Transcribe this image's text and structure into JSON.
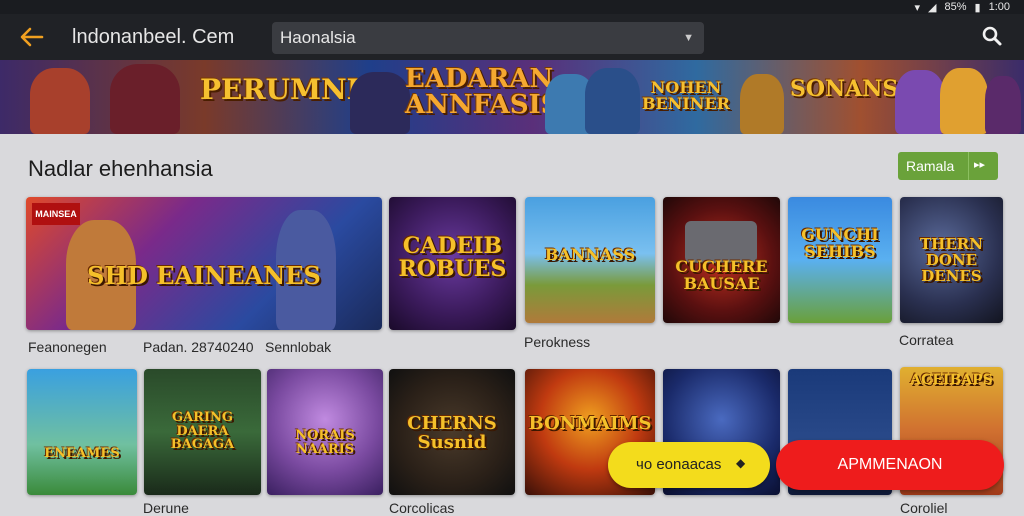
{
  "status_bar": {
    "battery": "85%",
    "time": "1:00"
  },
  "app_bar": {
    "back_icon": "arrow-left-icon",
    "title": "lndonanbeel. Cem",
    "url_value": "Haonalsia",
    "dropdown_icon": "caret-down-icon",
    "search_icon": "search-icon"
  },
  "banner": {
    "logos": [
      "PERUMNISA",
      "EADARAN ANNFASIS",
      "NOHEN BENINER",
      "SONANS"
    ]
  },
  "section": {
    "title": "Nadlar ehenhansia",
    "button_label": "Ramala",
    "button_icon": "chevron-icon"
  },
  "tiles_row1": [
    {
      "title": "SHD EAINEANES",
      "badge": "MAINSEA"
    },
    {
      "title": "CADEIB ROBUES"
    },
    {
      "title": "BANNASS"
    },
    {
      "title": "CUCHERE BAUSAE"
    },
    {
      "title": "GUNCHI SEHIBS"
    },
    {
      "title": "THERN DONE DENES"
    }
  ],
  "tiles_row2": [
    {
      "title": "ENEAMES"
    },
    {
      "title": "GARING DAERA BAGAGA"
    },
    {
      "title": "NORAIS NAARIS"
    },
    {
      "title": "CHERNS Susnid"
    },
    {
      "title": "BONMAIMS"
    },
    {
      "title": ""
    },
    {
      "title": ""
    },
    {
      "title": "ACEIBAPS"
    }
  ],
  "captions_row1": [
    "Feanonegen",
    "Padan. 28740240",
    "Sennlobak",
    "Perokness",
    "Corratea"
  ],
  "captions_row2": [
    "Derune",
    "Corcolicas",
    "Coroliel"
  ],
  "fab_yellow": {
    "label": "чo eonaacas",
    "icon": "gem-icon"
  },
  "fab_red": {
    "label": "APMMENAON"
  },
  "colors": {
    "accent_green": "#6aa23a",
    "accent_red": "#ee1c1c",
    "accent_yellow": "#f3dc1c",
    "back_arrow": "#f0a020"
  }
}
